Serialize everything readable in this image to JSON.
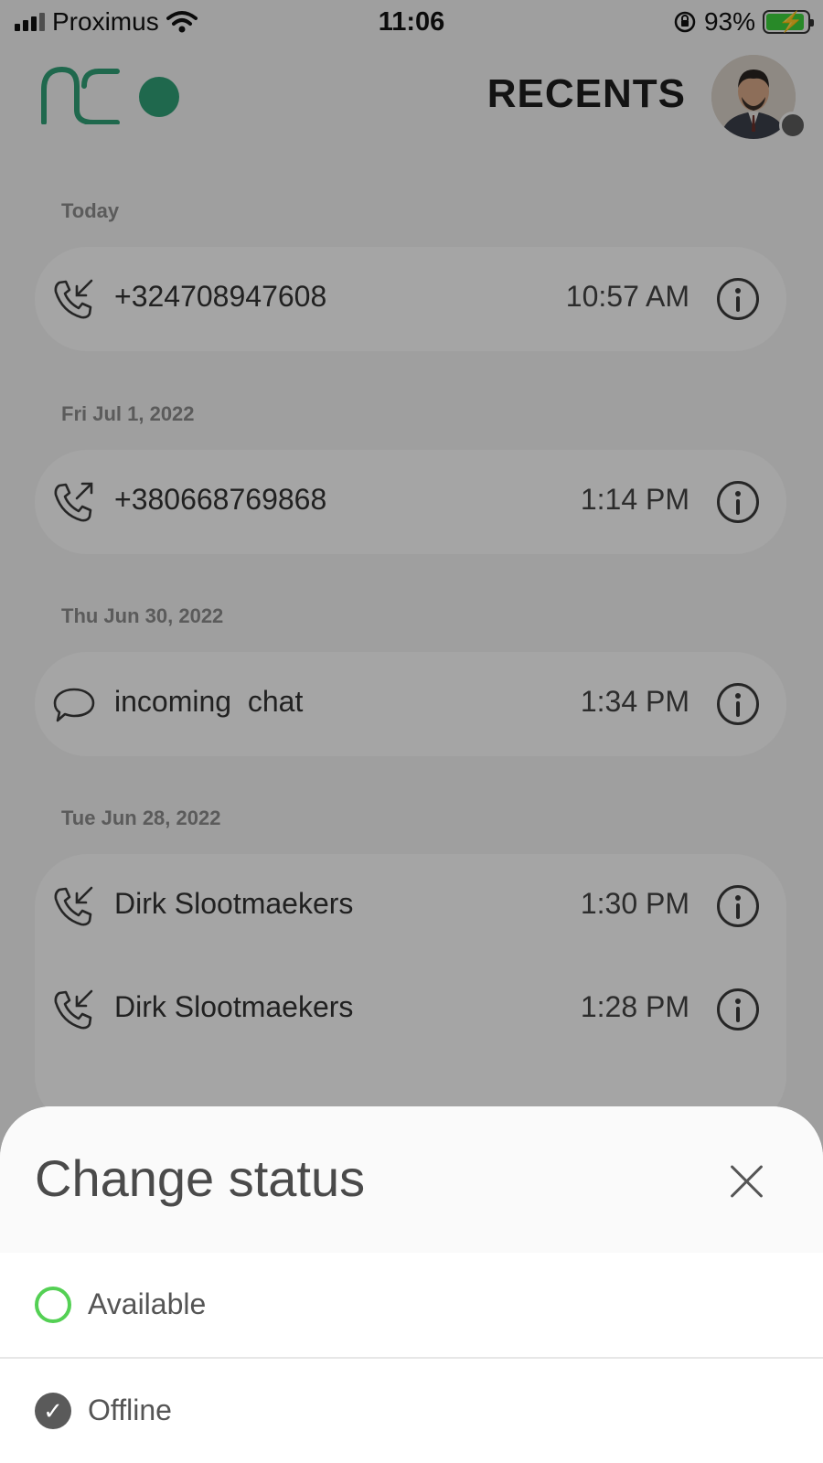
{
  "status_bar": {
    "carrier": "Proximus",
    "time": "11:06",
    "battery": "93%"
  },
  "header": {
    "title": "RECENTS"
  },
  "sections": [
    {
      "label": "Today",
      "rows": [
        {
          "title": "+324708947608",
          "time": "10:57 AM",
          "icon": "incoming-call-icon"
        }
      ]
    },
    {
      "label": "Fri Jul 1, 2022",
      "rows": [
        {
          "title": "+380668769868",
          "time": "1:14 PM",
          "icon": "outgoing-call-icon"
        }
      ]
    },
    {
      "label": "Thu Jun 30, 2022",
      "rows": [
        {
          "title": "incoming  chat",
          "time": "1:34 PM",
          "icon": "chat-bubble-icon"
        }
      ]
    },
    {
      "label": "Tue Jun 28, 2022",
      "rows": [
        {
          "title": "Dirk Slootmaekers",
          "time": "1:30 PM",
          "icon": "incoming-call-icon"
        },
        {
          "title": "Dirk Slootmaekers",
          "time": "1:28 PM",
          "icon": "incoming-call-icon"
        }
      ]
    }
  ],
  "sheet": {
    "title": "Change status",
    "options": [
      {
        "label": "Available",
        "selected": false
      },
      {
        "label": "Offline",
        "selected": true
      }
    ]
  },
  "colors": {
    "brand": "#2f9e75",
    "available": "#54d054",
    "offline": "#5a5a5a"
  }
}
